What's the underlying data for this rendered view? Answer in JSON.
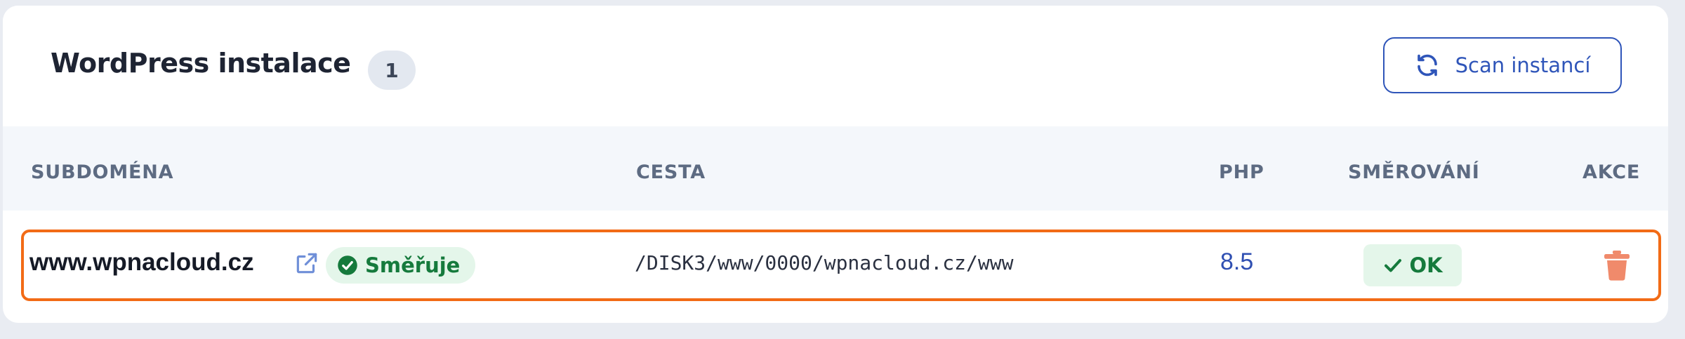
{
  "header": {
    "title": "WordPress instalace",
    "count": "1",
    "scan_button_label": "Scan instancí",
    "scan_icon": "refresh-icon"
  },
  "table": {
    "columns": [
      "SUBDOMÉNA",
      "CESTA",
      "PHP",
      "SMĚROVÁNÍ",
      "AKCE"
    ],
    "rows": [
      {
        "subdomain": "www.wpnacloud.cz",
        "external_link_icon": "external-link-icon",
        "status": "Směřuje",
        "status_icon": "check-circle-icon",
        "path": "/DISK3/www/0000/wpnacloud.cz/www",
        "php": "8.5",
        "routing": "OK",
        "routing_icon": "check-icon",
        "action_icon": "trash-icon"
      }
    ]
  },
  "colors": {
    "accent": "#2f55b9",
    "success_bg": "#e4f6ea",
    "success_text": "#157a3c",
    "highlight": "#f26b16",
    "danger": "#f08a6b"
  }
}
